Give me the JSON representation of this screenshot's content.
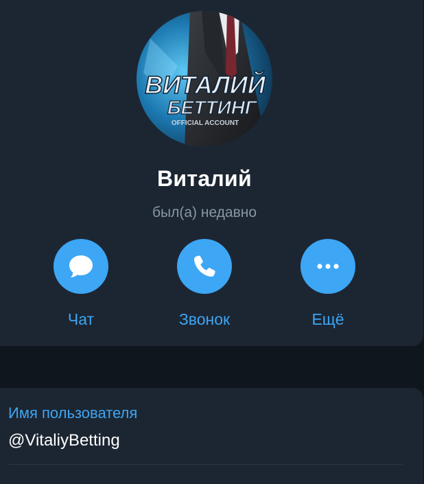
{
  "profile": {
    "name": "Виталий",
    "status": "был(а) недавно",
    "avatar": {
      "line1": "ВИТАЛИЙ",
      "line2": "БЕТТИНГ",
      "line3": "OFFICIAL ACCOUNT"
    }
  },
  "actions": [
    {
      "label": "Чат",
      "icon": "chat-bubble-icon"
    },
    {
      "label": "Звонок",
      "icon": "phone-icon"
    },
    {
      "label": "Ещё",
      "icon": "more-dots-icon"
    }
  ],
  "info": {
    "username_label": "Имя пользователя",
    "username_value": "@VitaliyBetting"
  },
  "colors": {
    "background": "#10161e",
    "card": "#1c2632",
    "accent": "#3da6f5",
    "text_primary": "#ffffff",
    "text_secondary": "#8b97a5"
  }
}
